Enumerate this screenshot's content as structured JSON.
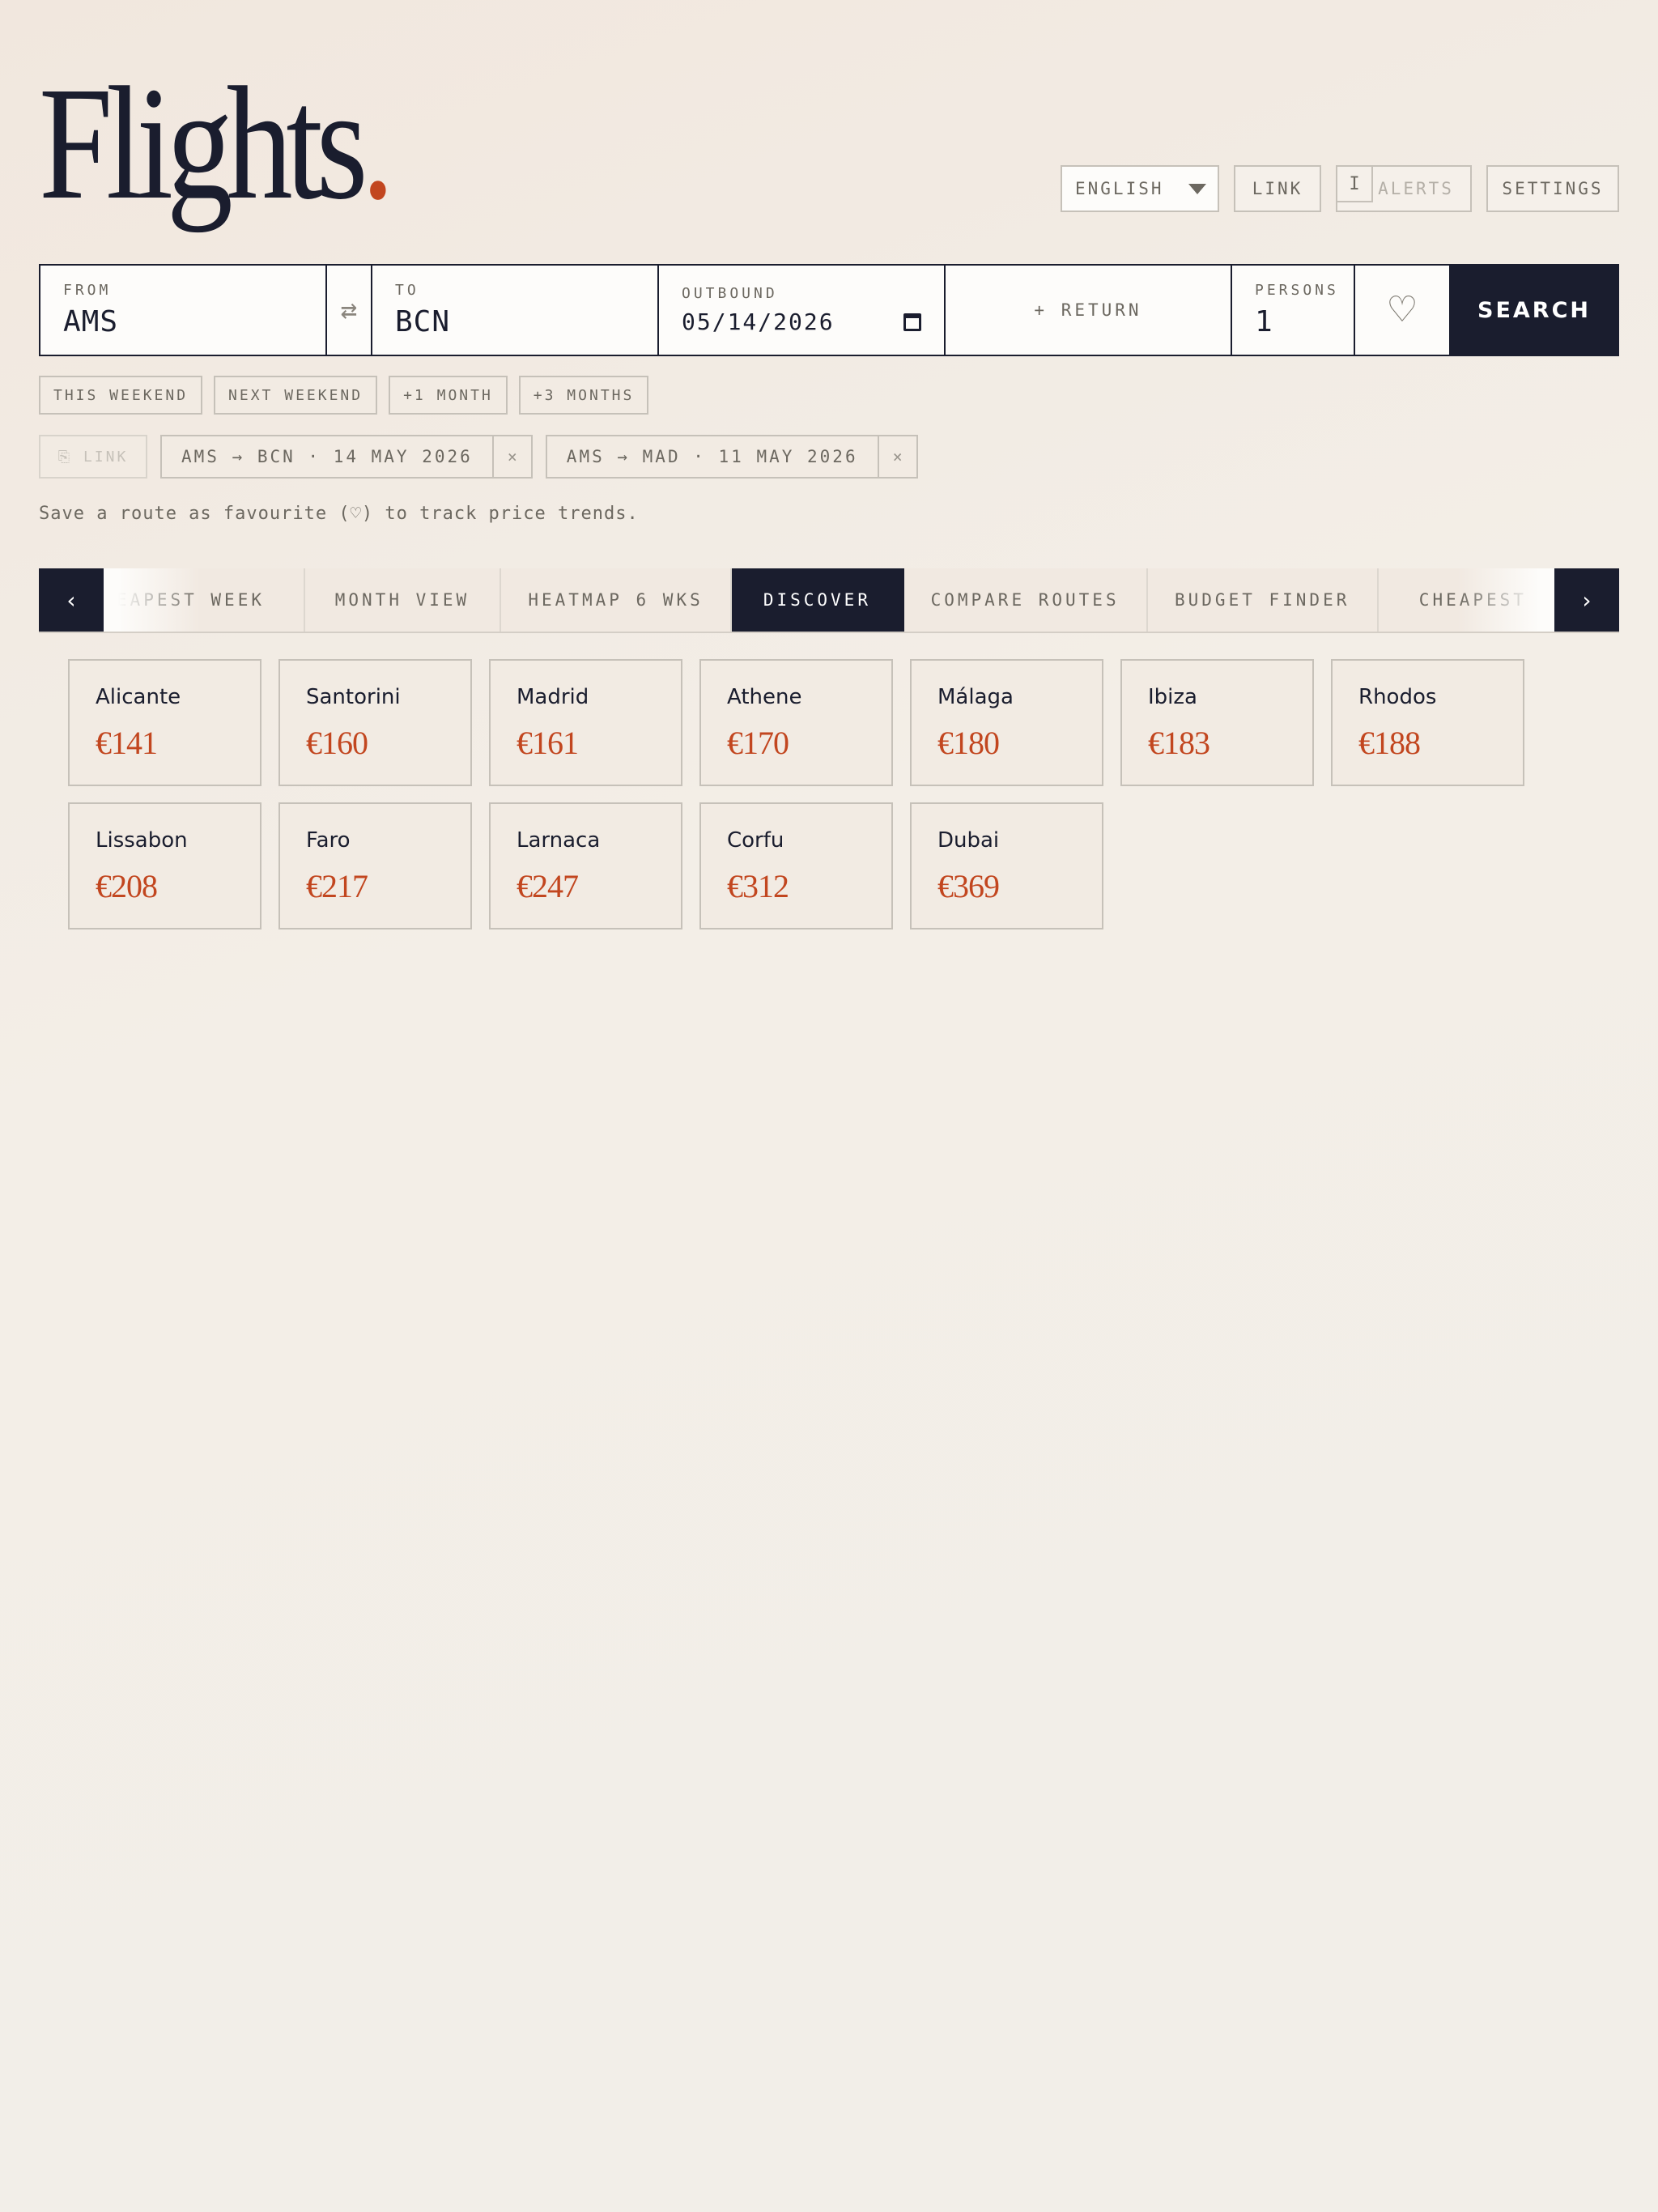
{
  "app": {
    "logo_text": "Flights",
    "logo_dot": ".",
    "accent_color": "#c2461f",
    "ink_color": "#1a1d2e"
  },
  "header": {
    "language": "ENGLISH",
    "link_label": "LINK",
    "alerts_info": "i",
    "alerts_label": "ALERTS",
    "settings_label": "SETTINGS"
  },
  "search": {
    "from_label": "FROM",
    "from_value": "AMS",
    "swap_icon": "⇄",
    "to_label": "TO",
    "to_value": "BCN",
    "outbound_label": "OUTBOUND",
    "outbound_value": "05/14/2026",
    "return_label": "+ RETURN",
    "persons_label": "PERSONS",
    "persons_value": "1",
    "favourite_icon": "♡",
    "search_label": "SEARCH"
  },
  "quick_ranges": [
    "THIS WEEKEND",
    "NEXT WEEKEND",
    "+1 MONTH",
    "+3 MONTHS"
  ],
  "saved": {
    "link_label": "⎘ LINK",
    "routes": [
      {
        "label": "AMS → BCN · 14 MAY 2026",
        "remove": "×"
      },
      {
        "label": "AMS → MAD · 11 MAY 2026",
        "remove": "×"
      }
    ]
  },
  "hint": "Save a route as favourite (♡) to track price trends.",
  "tabs": {
    "prev": "‹",
    "next": "›",
    "items": [
      {
        "label": "CHEAPEST WEEK"
      },
      {
        "label": "MONTH VIEW"
      },
      {
        "label": "HEATMAP 6 WKS"
      },
      {
        "label": "DISCOVER",
        "active": true
      },
      {
        "label": "COMPARE ROUTES"
      },
      {
        "label": "BUDGET FINDER"
      },
      {
        "label": "CHEAPEST"
      }
    ]
  },
  "destinations": [
    {
      "name": "Alicante",
      "price": "€141"
    },
    {
      "name": "Santorini",
      "price": "€160"
    },
    {
      "name": "Madrid",
      "price": "€161"
    },
    {
      "name": "Athene",
      "price": "€170"
    },
    {
      "name": "Málaga",
      "price": "€180"
    },
    {
      "name": "Ibiza",
      "price": "€183"
    },
    {
      "name": "Rhodos",
      "price": "€188"
    },
    {
      "name": "Lissabon",
      "price": "€208"
    },
    {
      "name": "Faro",
      "price": "€217"
    },
    {
      "name": "Larnaca",
      "price": "€247"
    },
    {
      "name": "Corfu",
      "price": "€312"
    },
    {
      "name": "Dubai",
      "price": "€369"
    }
  ]
}
